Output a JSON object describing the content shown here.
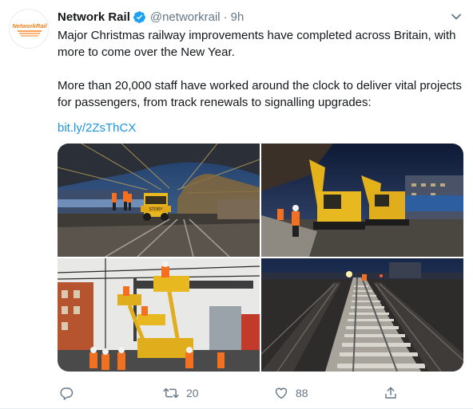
{
  "author": {
    "display_name": "Network Rail",
    "handle": "@networkrail",
    "separator": "·",
    "time": "9h",
    "logo_text": "NetworkRail"
  },
  "tweet": {
    "paragraph1": "Major Christmas railway improvements have completed across Britain, with more to come over the New Year.",
    "paragraph2": "More than 20,000 staff have worked around the clock to deliver vital projects for passengers, from track renewals to signalling upgrades:",
    "link": "bit.ly/2ZsThCX"
  },
  "media": {
    "photos": [
      {
        "name": "station-track-renewal-photo",
        "machine_label": "STORY"
      },
      {
        "name": "excavators-platform-photo"
      },
      {
        "name": "overhead-line-workers-photo"
      },
      {
        "name": "new-track-night-photo"
      }
    ]
  },
  "actions": {
    "reply_count": "",
    "retweet_count": "20",
    "like_count": "88"
  },
  "colors": {
    "accent": "#1da1f2",
    "link": "#1b95e0",
    "secondary_text": "#657786",
    "brand_orange": "#f58220"
  }
}
